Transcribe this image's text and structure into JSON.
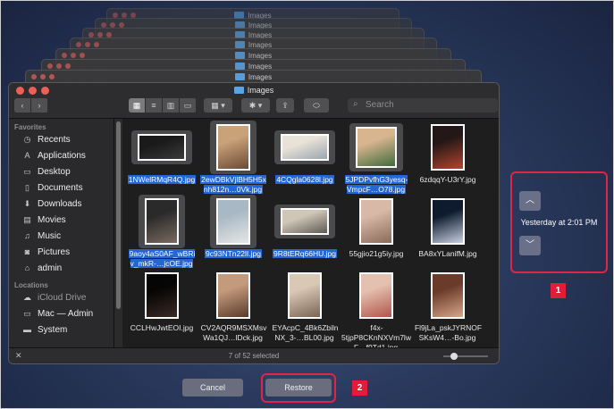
{
  "window": {
    "title": "Images",
    "stacked_title": "Images"
  },
  "toolbar": {
    "back": "‹",
    "forward": "›",
    "view_icons": [
      "▦",
      "≡",
      "▥",
      "▭"
    ],
    "group_label": "▦ ▾",
    "action_label": "✱ ▾",
    "share_label": "⇪",
    "tag_label": "⬭",
    "search_placeholder": "Search"
  },
  "sidebar": {
    "favorites_heading": "Favorites",
    "favorites": [
      {
        "icon": "clock-icon",
        "glyph": "◷",
        "label": "Recents"
      },
      {
        "icon": "applications-icon",
        "glyph": "A",
        "label": "Applications"
      },
      {
        "icon": "desktop-icon",
        "glyph": "▭",
        "label": "Desktop"
      },
      {
        "icon": "document-icon",
        "glyph": "▯",
        "label": "Documents"
      },
      {
        "icon": "download-icon",
        "glyph": "⬇",
        "label": "Downloads"
      },
      {
        "icon": "film-icon",
        "glyph": "▤",
        "label": "Movies"
      },
      {
        "icon": "music-icon",
        "glyph": "♫",
        "label": "Music"
      },
      {
        "icon": "camera-icon",
        "glyph": "◙",
        "label": "Pictures"
      },
      {
        "icon": "home-icon",
        "glyph": "⌂",
        "label": "admin"
      }
    ],
    "locations_heading": "Locations",
    "locations": [
      {
        "icon": "cloud-icon",
        "glyph": "☁",
        "label": "iCloud Drive",
        "dim": true
      },
      {
        "icon": "laptop-icon",
        "glyph": "▭",
        "label": "Mac — Admin",
        "dim": false
      },
      {
        "icon": "disk-icon",
        "glyph": "▬",
        "label": "System",
        "dim": false
      }
    ]
  },
  "files": [
    {
      "name": "1NWelRMqR4Q.jpg",
      "selected": true,
      "colors": [
        "#1a1a1a",
        "#3a3a3a"
      ],
      "shape": "wide"
    },
    {
      "name": "2ewDBkVjlBH5H5xnh812n…0Vk.jpg",
      "selected": true,
      "colors": [
        "#c9a27a",
        "#6b4a34"
      ],
      "shape": "tall"
    },
    {
      "name": "4CQgla0628l.jpg",
      "selected": true,
      "colors": [
        "#e9e2d8",
        "#9aa6b0"
      ],
      "shape": "wide"
    },
    {
      "name": "5JPDPvfhG3yesq-VmpcF…O78.jpg",
      "selected": true,
      "colors": [
        "#d9b58f",
        "#3f6b3c"
      ],
      "shape": "square"
    },
    {
      "name": "6zdqqY-U3rY.jpg",
      "selected": false,
      "colors": [
        "#231717",
        "#b5452f"
      ],
      "shape": "tall"
    },
    {
      "name": "9aoy4aS0AF_wBRiv_mkR-…jcOE.jpg",
      "selected": true,
      "colors": [
        "#2a2a2a",
        "#7a6a60"
      ],
      "shape": "tall"
    },
    {
      "name": "9c93NTn22lI.jpg",
      "selected": true,
      "colors": [
        "#a8b8c4",
        "#e6e6e6"
      ],
      "shape": "tall"
    },
    {
      "name": "9R8tERq66HU.jpg",
      "selected": true,
      "colors": [
        "#cfc6b8",
        "#5f5a52"
      ],
      "shape": "wide"
    },
    {
      "name": "55gjio21g5iy.jpg",
      "selected": false,
      "colors": [
        "#d8b8a6",
        "#8a6a5a"
      ],
      "shape": "tall"
    },
    {
      "name": "BA8xYLanifM.jpg",
      "selected": false,
      "colors": [
        "#0e1a2e",
        "#c7d1e0"
      ],
      "shape": "tall"
    },
    {
      "name": "CCLHwJwtEOI.jpg",
      "selected": false,
      "colors": [
        "#050505",
        "#3b2a22"
      ],
      "shape": "tall"
    },
    {
      "name": "CV2AQR9MSXMsvWa1QJ…lDck.jpg",
      "selected": false,
      "colors": [
        "#c49a7c",
        "#5a3a2a"
      ],
      "shape": "tall"
    },
    {
      "name": "EYAcpC_4Bk6ZbilnNX_3-…BL00.jpg",
      "selected": false,
      "colors": [
        "#d8c8b4",
        "#7a6454"
      ],
      "shape": "tall"
    },
    {
      "name": "f4x-5tjpP8CKnNXVm7lwF…f9Td1.jpg",
      "selected": false,
      "colors": [
        "#e4c0b0",
        "#b0564a"
      ],
      "shape": "tall"
    },
    {
      "name": "Fl9jLa_pskJYRNOFSKsW4…-Bo.jpg",
      "selected": false,
      "colors": [
        "#6a3a2a",
        "#d8a688"
      ],
      "shape": "tall"
    }
  ],
  "status": {
    "selection_text": "7 of 52 selected",
    "close_glyph": "✕",
    "zoom_level": 0.2
  },
  "time_machine": {
    "up_glyph": "︿",
    "down_glyph": "﹀",
    "timestamp": "Yesterday at 2:01 PM"
  },
  "buttons": {
    "cancel": "Cancel",
    "restore": "Restore"
  },
  "badges": {
    "one": "1",
    "two": "2"
  }
}
